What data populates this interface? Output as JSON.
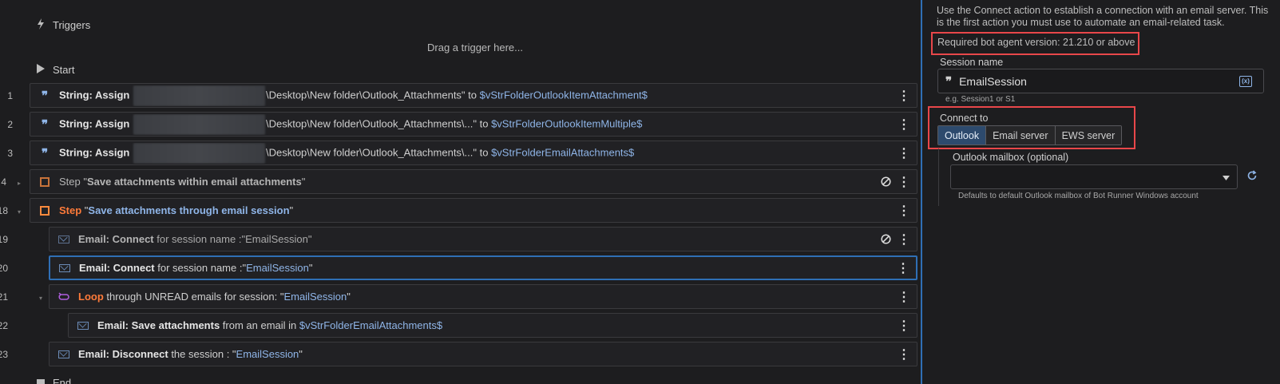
{
  "triggers": {
    "label": "Triggers",
    "drag_hint": "Drag a trigger here..."
  },
  "start": {
    "label": "Start"
  },
  "end": {
    "label": "End"
  },
  "rows": [
    {
      "num": "1",
      "prefix": "String: Assign",
      "middle": "\\Desktop\\New folder\\Outlook_Attachments\"",
      "conj": " to ",
      "var": "$vStrFolderOutlookItemAttachment$"
    },
    {
      "num": "2",
      "prefix": "String: Assign",
      "middle": "\\Desktop\\New folder\\Outlook_Attachments\\...\"",
      "conj": " to ",
      "var": "$vStrFolderOutlookItemMultiple$"
    },
    {
      "num": "3",
      "prefix": "String: Assign",
      "middle": "\\Desktop\\New folder\\Outlook_Attachments\\...\"",
      "conj": " to ",
      "var": "$vStrFolderEmailAttachments$"
    },
    {
      "num": "4",
      "prefix": "Step",
      "open": " \"",
      "var": "Save attachments within email attachments",
      "close": "\""
    },
    {
      "num": "18",
      "prefix": "Step",
      "open": " \"",
      "var": "Save attachments through email session",
      "close": "\""
    },
    {
      "num": "19",
      "prefix": "Email: Connect",
      "mid": " for session name :\"",
      "var": "EmailSession",
      "close": "\""
    },
    {
      "num": "20",
      "prefix": "Email: Connect",
      "mid": " for session name :\"",
      "var": "EmailSession",
      "close": "\""
    },
    {
      "num": "21",
      "prefix": "Loop",
      "mid": " through UNREAD emails for session: \"",
      "var": "EmailSession",
      "close": "\""
    },
    {
      "num": "22",
      "prefix": "Email: Save attachments",
      "mid": " from an email in ",
      "var": "$vStrFolderEmailAttachments$"
    },
    {
      "num": "23",
      "prefix": "Email: Disconnect",
      "mid": " the session : \"",
      "var": "EmailSession",
      "close": "\""
    }
  ],
  "panel": {
    "description": "Use the Connect action to establish a connection with an email server. This is the first action you must use to automate an email-related task.",
    "required_version": "Required bot agent version: 21.210 or above",
    "session_label": "Session name",
    "session_value": "EmailSession",
    "session_hint": "e.g. Session1 or S1",
    "connect_label": "Connect to",
    "connect_options": [
      "Outlook",
      "Email server",
      "EWS server"
    ],
    "connect_selected": "Outlook",
    "mailbox_label": "Outlook mailbox (optional)",
    "mailbox_value": "",
    "mailbox_hint": "Defaults to default Outlook mailbox of Bot Runner Windows account"
  },
  "colors": {
    "accent": "#2f6fb5",
    "highlight_box": "#e8474a",
    "step_orange": "#ff7b3a",
    "variable_blue": "#8fb5e8",
    "loop_purple": "#b15fe0"
  }
}
